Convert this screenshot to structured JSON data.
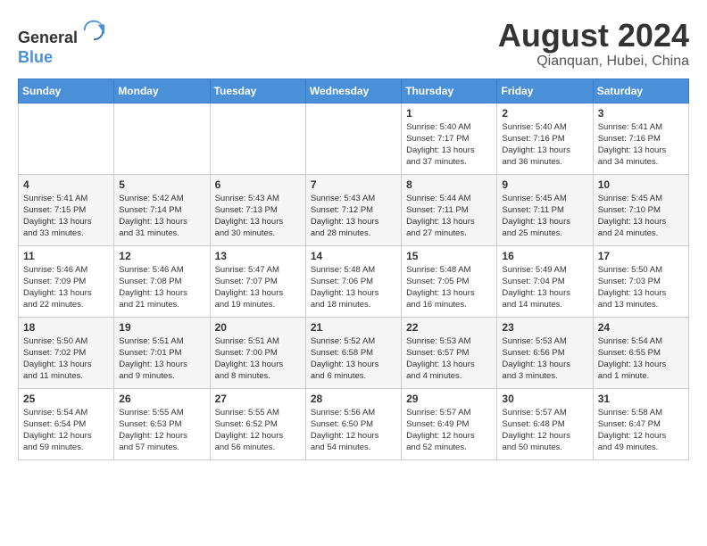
{
  "header": {
    "logo_line1": "General",
    "logo_line2": "Blue",
    "month_year": "August 2024",
    "location": "Qianquan, Hubei, China"
  },
  "weekdays": [
    "Sunday",
    "Monday",
    "Tuesday",
    "Wednesday",
    "Thursday",
    "Friday",
    "Saturday"
  ],
  "weeks": [
    [
      {
        "day": "",
        "info": ""
      },
      {
        "day": "",
        "info": ""
      },
      {
        "day": "",
        "info": ""
      },
      {
        "day": "",
        "info": ""
      },
      {
        "day": "1",
        "info": "Sunrise: 5:40 AM\nSunset: 7:17 PM\nDaylight: 13 hours\nand 37 minutes."
      },
      {
        "day": "2",
        "info": "Sunrise: 5:40 AM\nSunset: 7:16 PM\nDaylight: 13 hours\nand 36 minutes."
      },
      {
        "day": "3",
        "info": "Sunrise: 5:41 AM\nSunset: 7:16 PM\nDaylight: 13 hours\nand 34 minutes."
      }
    ],
    [
      {
        "day": "4",
        "info": "Sunrise: 5:41 AM\nSunset: 7:15 PM\nDaylight: 13 hours\nand 33 minutes."
      },
      {
        "day": "5",
        "info": "Sunrise: 5:42 AM\nSunset: 7:14 PM\nDaylight: 13 hours\nand 31 minutes."
      },
      {
        "day": "6",
        "info": "Sunrise: 5:43 AM\nSunset: 7:13 PM\nDaylight: 13 hours\nand 30 minutes."
      },
      {
        "day": "7",
        "info": "Sunrise: 5:43 AM\nSunset: 7:12 PM\nDaylight: 13 hours\nand 28 minutes."
      },
      {
        "day": "8",
        "info": "Sunrise: 5:44 AM\nSunset: 7:11 PM\nDaylight: 13 hours\nand 27 minutes."
      },
      {
        "day": "9",
        "info": "Sunrise: 5:45 AM\nSunset: 7:11 PM\nDaylight: 13 hours\nand 25 minutes."
      },
      {
        "day": "10",
        "info": "Sunrise: 5:45 AM\nSunset: 7:10 PM\nDaylight: 13 hours\nand 24 minutes."
      }
    ],
    [
      {
        "day": "11",
        "info": "Sunrise: 5:46 AM\nSunset: 7:09 PM\nDaylight: 13 hours\nand 22 minutes."
      },
      {
        "day": "12",
        "info": "Sunrise: 5:46 AM\nSunset: 7:08 PM\nDaylight: 13 hours\nand 21 minutes."
      },
      {
        "day": "13",
        "info": "Sunrise: 5:47 AM\nSunset: 7:07 PM\nDaylight: 13 hours\nand 19 minutes."
      },
      {
        "day": "14",
        "info": "Sunrise: 5:48 AM\nSunset: 7:06 PM\nDaylight: 13 hours\nand 18 minutes."
      },
      {
        "day": "15",
        "info": "Sunrise: 5:48 AM\nSunset: 7:05 PM\nDaylight: 13 hours\nand 16 minutes."
      },
      {
        "day": "16",
        "info": "Sunrise: 5:49 AM\nSunset: 7:04 PM\nDaylight: 13 hours\nand 14 minutes."
      },
      {
        "day": "17",
        "info": "Sunrise: 5:50 AM\nSunset: 7:03 PM\nDaylight: 13 hours\nand 13 minutes."
      }
    ],
    [
      {
        "day": "18",
        "info": "Sunrise: 5:50 AM\nSunset: 7:02 PM\nDaylight: 13 hours\nand 11 minutes."
      },
      {
        "day": "19",
        "info": "Sunrise: 5:51 AM\nSunset: 7:01 PM\nDaylight: 13 hours\nand 9 minutes."
      },
      {
        "day": "20",
        "info": "Sunrise: 5:51 AM\nSunset: 7:00 PM\nDaylight: 13 hours\nand 8 minutes."
      },
      {
        "day": "21",
        "info": "Sunrise: 5:52 AM\nSunset: 6:58 PM\nDaylight: 13 hours\nand 6 minutes."
      },
      {
        "day": "22",
        "info": "Sunrise: 5:53 AM\nSunset: 6:57 PM\nDaylight: 13 hours\nand 4 minutes."
      },
      {
        "day": "23",
        "info": "Sunrise: 5:53 AM\nSunset: 6:56 PM\nDaylight: 13 hours\nand 3 minutes."
      },
      {
        "day": "24",
        "info": "Sunrise: 5:54 AM\nSunset: 6:55 PM\nDaylight: 13 hours\nand 1 minute."
      }
    ],
    [
      {
        "day": "25",
        "info": "Sunrise: 5:54 AM\nSunset: 6:54 PM\nDaylight: 12 hours\nand 59 minutes."
      },
      {
        "day": "26",
        "info": "Sunrise: 5:55 AM\nSunset: 6:53 PM\nDaylight: 12 hours\nand 57 minutes."
      },
      {
        "day": "27",
        "info": "Sunrise: 5:55 AM\nSunset: 6:52 PM\nDaylight: 12 hours\nand 56 minutes."
      },
      {
        "day": "28",
        "info": "Sunrise: 5:56 AM\nSunset: 6:50 PM\nDaylight: 12 hours\nand 54 minutes."
      },
      {
        "day": "29",
        "info": "Sunrise: 5:57 AM\nSunset: 6:49 PM\nDaylight: 12 hours\nand 52 minutes."
      },
      {
        "day": "30",
        "info": "Sunrise: 5:57 AM\nSunset: 6:48 PM\nDaylight: 12 hours\nand 50 minutes."
      },
      {
        "day": "31",
        "info": "Sunrise: 5:58 AM\nSunset: 6:47 PM\nDaylight: 12 hours\nand 49 minutes."
      }
    ]
  ]
}
